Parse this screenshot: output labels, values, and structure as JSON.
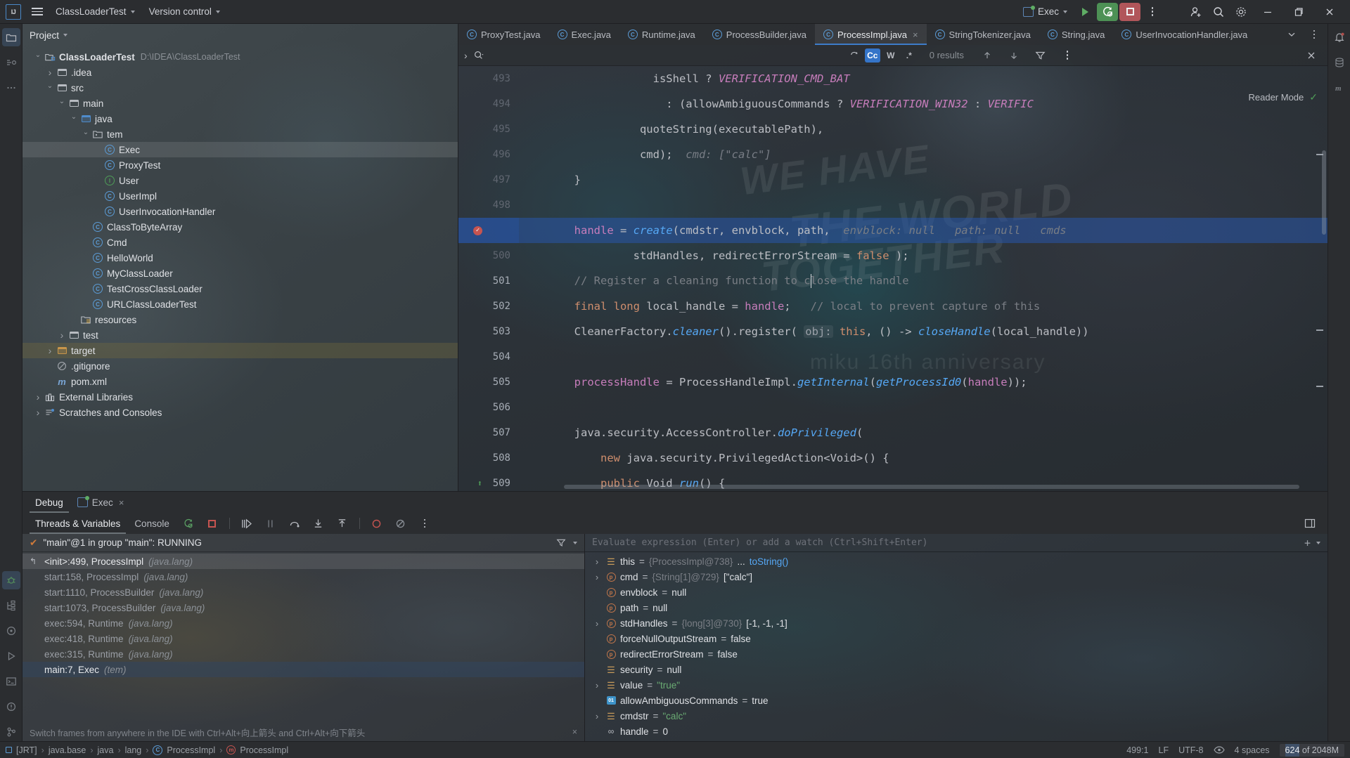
{
  "titlebar": {
    "logo": "IJ",
    "menu_icon": "hamburger-menu-icon",
    "project_name": "ClassLoaderTest",
    "version_control": "Version control",
    "run_config": "Exec",
    "run_icon": "run-icon",
    "debug_icon": "rerun-debug-icon",
    "stop_icon": "stop-icon",
    "more_icon": "more-options-icon",
    "account_icon": "account-icon",
    "search_icon": "search-icon",
    "settings_icon": "settings-gear-icon",
    "minimize_icon": "minimize-icon",
    "maximize_icon": "maximize-icon",
    "close_icon": "close-icon"
  },
  "project": {
    "panel_title": "Project",
    "tree": [
      {
        "label": "ClassLoaderTest",
        "path": "D:\\IDEA\\ClassLoaderTest",
        "indent": 0,
        "arrow": "down",
        "icon": "module-folder",
        "bold": true
      },
      {
        "label": ".idea",
        "indent": 1,
        "arrow": "right",
        "icon": "folder"
      },
      {
        "label": "src",
        "indent": 1,
        "arrow": "down",
        "icon": "folder"
      },
      {
        "label": "main",
        "indent": 2,
        "arrow": "down",
        "icon": "folder"
      },
      {
        "label": "java",
        "indent": 3,
        "arrow": "down",
        "icon": "folder-blue"
      },
      {
        "label": "tem",
        "indent": 4,
        "arrow": "down",
        "icon": "package"
      },
      {
        "label": "Exec",
        "indent": 5,
        "arrow": "",
        "icon": "class",
        "state": "selected"
      },
      {
        "label": "ProxyTest",
        "indent": 5,
        "arrow": "",
        "icon": "class"
      },
      {
        "label": "User",
        "indent": 5,
        "arrow": "",
        "icon": "interface"
      },
      {
        "label": "UserImpl",
        "indent": 5,
        "arrow": "",
        "icon": "class"
      },
      {
        "label": "UserInvocationHandler",
        "indent": 5,
        "arrow": "",
        "icon": "class"
      },
      {
        "label": "ClassToByteArray",
        "indent": 4,
        "arrow": "",
        "icon": "class"
      },
      {
        "label": "Cmd",
        "indent": 4,
        "arrow": "",
        "icon": "class"
      },
      {
        "label": "HelloWorld",
        "indent": 4,
        "arrow": "",
        "icon": "class"
      },
      {
        "label": "MyClassLoader",
        "indent": 4,
        "arrow": "",
        "icon": "class"
      },
      {
        "label": "TestCrossClassLoader",
        "indent": 4,
        "arrow": "",
        "icon": "class"
      },
      {
        "label": "URLClassLoaderTest",
        "indent": 4,
        "arrow": "",
        "icon": "class"
      },
      {
        "label": "resources",
        "indent": 3,
        "arrow": "",
        "icon": "resource-folder"
      },
      {
        "label": "test",
        "indent": 2,
        "arrow": "right",
        "icon": "folder"
      },
      {
        "label": "target",
        "indent": 1,
        "arrow": "right",
        "icon": "folder-orange",
        "state": "olive"
      },
      {
        "label": ".gitignore",
        "indent": 1,
        "arrow": "",
        "icon": "ignored-file"
      },
      {
        "label": "pom.xml",
        "indent": 1,
        "arrow": "",
        "icon": "maven"
      },
      {
        "label": "External Libraries",
        "indent": 0,
        "arrow": "right",
        "icon": "libraries"
      },
      {
        "label": "Scratches and Consoles",
        "indent": 0,
        "arrow": "right",
        "icon": "scratches"
      }
    ]
  },
  "editor": {
    "tabs": [
      {
        "label": "ProxyTest.java",
        "active": false
      },
      {
        "label": "Exec.java",
        "active": false
      },
      {
        "label": "Runtime.java",
        "active": false
      },
      {
        "label": "ProcessBuilder.java",
        "active": false
      },
      {
        "label": "ProcessImpl.java",
        "active": true,
        "closable": true
      },
      {
        "label": "StringTokenizer.java",
        "active": false
      },
      {
        "label": "String.java",
        "active": false
      },
      {
        "label": "UserInvocationHandler.java",
        "active": false
      }
    ],
    "tabs_overflow_icon": "chevron-down-icon",
    "tabs_more_icon": "more-options-icon",
    "notifications_icon": "notifications-bell-icon",
    "find": {
      "expand_icon": "chevron-right-icon",
      "search_icon": "search-dropdown-icon",
      "value": "",
      "regex_history_icon": "search-history-icon",
      "match_case": "Cc",
      "words": "W",
      "regex": ".*",
      "results": "0 results",
      "prev_icon": "arrow-up-icon",
      "next_icon": "arrow-down-icon",
      "filter_icon": "filter-icon",
      "more_icon": "more-options-icon",
      "close_icon": "close-icon"
    },
    "reader_mode": "Reader Mode",
    "reader_check_icon": "checkmark-icon",
    "lines": [
      {
        "n": "493",
        "dim": true,
        "tokens": [
          {
            "t": "                    ",
            "c": "plain"
          },
          {
            "t": "isShell ",
            "c": "plain"
          },
          {
            "t": "? ",
            "c": "plain"
          },
          {
            "t": "VERIFICATION_CMD_BAT",
            "c": "cnst"
          }
        ]
      },
      {
        "n": "494",
        "dim": true,
        "tokens": [
          {
            "t": "                      : (",
            "c": "plain"
          },
          {
            "t": "allowAmbiguousCommands ",
            "c": "plain"
          },
          {
            "t": "? ",
            "c": "plain"
          },
          {
            "t": "VERIFICATION_WIN32",
            "c": "cnst"
          },
          {
            "t": " : ",
            "c": "plain"
          },
          {
            "t": "VERIFIC",
            "c": "cnst"
          }
        ]
      },
      {
        "n": "495",
        "dim": true,
        "tokens": [
          {
            "t": "                  quoteString(executablePath),",
            "c": "plain"
          }
        ]
      },
      {
        "n": "496",
        "dim": true,
        "tokens": [
          {
            "t": "                  cmd);  ",
            "c": "plain"
          },
          {
            "t": "cmd: [\"calc\"]",
            "c": "hint"
          }
        ]
      },
      {
        "n": "497",
        "dim": true,
        "tokens": [
          {
            "t": "        }",
            "c": "plain"
          }
        ]
      },
      {
        "n": "498",
        "dim": true,
        "tokens": [
          {
            "t": "",
            "c": "plain"
          }
        ]
      },
      {
        "n": "499",
        "dim": false,
        "exec": true,
        "breakpoint": true,
        "tokens": [
          {
            "t": "        ",
            "c": "plain"
          },
          {
            "t": "handle",
            "c": "fld"
          },
          {
            "t": " = ",
            "c": "plain"
          },
          {
            "t": "create",
            "c": "mth"
          },
          {
            "t": "(cmdstr, envblock, path,  ",
            "c": "plain"
          },
          {
            "t": "envblock: null",
            "c": "hint"
          },
          {
            "t": "   ",
            "c": "plain"
          },
          {
            "t": "path: null",
            "c": "hint"
          },
          {
            "t": "   ",
            "c": "plain"
          },
          {
            "t": "cmds",
            "c": "hint"
          }
        ]
      },
      {
        "n": "500",
        "dim": true,
        "tokens": [
          {
            "t": "                 stdHandles, redirectErrorStream ",
            "c": "plain"
          },
          {
            "t": "= ",
            "c": "plain"
          },
          {
            "t": "false",
            "c": "kw"
          },
          {
            "t": " );",
            "c": "plain"
          }
        ]
      },
      {
        "n": "501",
        "dim": false,
        "cursor": true,
        "tokens": [
          {
            "t": "        ",
            "c": "plain"
          },
          {
            "t": "// Register a cleaning function to close the handle",
            "c": "cmt"
          }
        ]
      },
      {
        "n": "502",
        "dim": false,
        "tokens": [
          {
            "t": "        ",
            "c": "plain"
          },
          {
            "t": "final long",
            "c": "kw"
          },
          {
            "t": " local_handle = ",
            "c": "plain"
          },
          {
            "t": "handle",
            "c": "fld"
          },
          {
            "t": ";   ",
            "c": "plain"
          },
          {
            "t": "// local to prevent capture of this",
            "c": "cmt"
          }
        ]
      },
      {
        "n": "503",
        "dim": false,
        "tokens": [
          {
            "t": "        CleanerFactory.",
            "c": "plain"
          },
          {
            "t": "cleaner",
            "c": "mth"
          },
          {
            "t": "().register( ",
            "c": "plain"
          },
          {
            "t": "obj:",
            "c": "hintbox"
          },
          {
            "t": " ",
            "c": "plain"
          },
          {
            "t": "this",
            "c": "kw"
          },
          {
            "t": ", () -> ",
            "c": "plain"
          },
          {
            "t": "closeHandle",
            "c": "mth"
          },
          {
            "t": "(local_handle))",
            "c": "plain"
          }
        ]
      },
      {
        "n": "504",
        "dim": false,
        "tokens": [
          {
            "t": "",
            "c": "plain"
          }
        ]
      },
      {
        "n": "505",
        "dim": false,
        "tokens": [
          {
            "t": "        ",
            "c": "plain"
          },
          {
            "t": "processHandle",
            "c": "fld"
          },
          {
            "t": " = ProcessHandleImpl.",
            "c": "plain"
          },
          {
            "t": "getInternal",
            "c": "mth"
          },
          {
            "t": "(",
            "c": "plain"
          },
          {
            "t": "getProcessId0",
            "c": "mth"
          },
          {
            "t": "(",
            "c": "plain"
          },
          {
            "t": "handle",
            "c": "fld"
          },
          {
            "t": "));",
            "c": "plain"
          }
        ]
      },
      {
        "n": "506",
        "dim": false,
        "tokens": [
          {
            "t": "",
            "c": "plain"
          }
        ]
      },
      {
        "n": "507",
        "dim": false,
        "tokens": [
          {
            "t": "        java.security.AccessController.",
            "c": "plain"
          },
          {
            "t": "doPrivileged",
            "c": "mth"
          },
          {
            "t": "(",
            "c": "plain"
          }
        ]
      },
      {
        "n": "508",
        "dim": false,
        "tokens": [
          {
            "t": "            ",
            "c": "plain"
          },
          {
            "t": "new",
            "c": "kw"
          },
          {
            "t": " java.security.PrivilegedAction<Void>() {",
            "c": "plain"
          }
        ]
      },
      {
        "n": "509",
        "dim": false,
        "override": true,
        "tokens": [
          {
            "t": "            ",
            "c": "plain"
          },
          {
            "t": "public",
            "c": "kw"
          },
          {
            "t": " Void ",
            "c": "plain"
          },
          {
            "t": "run",
            "c": "mth"
          },
          {
            "t": "() {",
            "c": "plain"
          }
        ]
      }
    ],
    "watermark_lines": [
      "WE HAVE",
      "THE WORLD",
      "TOGETHER",
      "miku 16th anniversary"
    ]
  },
  "debug": {
    "tabs": [
      {
        "label": "Debug",
        "active": true
      },
      {
        "label": "Exec",
        "active": false,
        "closable": true,
        "icon": "run-config-icon"
      }
    ],
    "subtabs": [
      {
        "label": "Threads & Variables",
        "active": true
      },
      {
        "label": "Console",
        "active": false
      }
    ],
    "tool_icons": [
      "rerun-icon",
      "stop-icon",
      "resume-program-icon",
      "pause-program-icon",
      "step-over-icon",
      "step-into-icon",
      "step-out-icon",
      "view-breakpoints-icon",
      "mute-breakpoints-icon",
      "more-options-icon"
    ],
    "filter_icon": "filter-icon",
    "settings_icon": "chevron-down-icon",
    "thread": "\"main\"@1 in group \"main\": RUNNING",
    "thread_status_icon": "running-checkmark-icon",
    "frames": [
      {
        "label": "<init>:499, ProcessImpl",
        "pkg": "(java.lang)",
        "state": "selected",
        "icon": "current-frame-icon"
      },
      {
        "label": "start:158, ProcessImpl",
        "pkg": "(java.lang)",
        "state": "dim"
      },
      {
        "label": "start:1110, ProcessBuilder",
        "pkg": "(java.lang)",
        "state": "dim"
      },
      {
        "label": "start:1073, ProcessBuilder",
        "pkg": "(java.lang)",
        "state": "dim"
      },
      {
        "label": "exec:594, Runtime",
        "pkg": "(java.lang)",
        "state": "dim"
      },
      {
        "label": "exec:418, Runtime",
        "pkg": "(java.lang)",
        "state": "dim"
      },
      {
        "label": "exec:315, Runtime",
        "pkg": "(java.lang)",
        "state": "dim"
      },
      {
        "label": "main:7, Exec",
        "pkg": "(tem)",
        "state": "highlighted"
      }
    ],
    "frames_hint": "Switch frames from anywhere in the IDE with Ctrl+Alt+向上箭头 and Ctrl+Alt+向下箭头",
    "frames_hint_close_icon": "close-icon",
    "eval_placeholder": "Evaluate expression (Enter) or add a watch (Ctrl+Shift+Enter)",
    "eval_add_icon": "add-watch-icon",
    "eval_collapse_icon": "chevron-down-icon",
    "variables": [
      {
        "expandable": true,
        "icon": "field",
        "name": "this",
        "eq": "=",
        "ref": "{ProcessImpl@738}",
        "extra": " ... ",
        "link": "toString()"
      },
      {
        "expandable": true,
        "icon": "param",
        "name": "cmd",
        "eq": "=",
        "ref": "{String[1]@729}",
        "value": " [\"calc\"]"
      },
      {
        "expandable": false,
        "icon": "param",
        "name": "envblock",
        "eq": "=",
        "value": " null"
      },
      {
        "expandable": false,
        "icon": "param",
        "name": "path",
        "eq": "=",
        "value": " null"
      },
      {
        "expandable": true,
        "icon": "param",
        "name": "stdHandles",
        "eq": "=",
        "ref": "{long[3]@730}",
        "value": " [-1, -1, -1]"
      },
      {
        "expandable": false,
        "icon": "param",
        "name": "forceNullOutputStream",
        "eq": "=",
        "value": " false"
      },
      {
        "expandable": false,
        "icon": "param",
        "name": "redirectErrorStream",
        "eq": "=",
        "value": " false"
      },
      {
        "expandable": false,
        "icon": "field",
        "name": "security",
        "eq": "=",
        "value": " null"
      },
      {
        "expandable": true,
        "icon": "field",
        "name": "value",
        "eq": "=",
        "str": " \"true\""
      },
      {
        "expandable": false,
        "icon": "bool",
        "name": "allowAmbiguousCommands",
        "eq": "=",
        "value": " true"
      },
      {
        "expandable": true,
        "icon": "field",
        "name": "cmdstr",
        "eq": "=",
        "str": " \"calc\""
      },
      {
        "expandable": false,
        "icon": "prim",
        "name": "handle",
        "eq": "=",
        "value": " 0"
      }
    ]
  },
  "statusbar": {
    "breadcrumbs": [
      "[JRT]",
      "java.base",
      "java",
      "lang",
      "ProcessImpl",
      "ProcessImpl"
    ],
    "caret": "499:1",
    "line_sep": "LF",
    "encoding": "UTF-8",
    "eye_icon": "reader-mode-icon",
    "indent": "4 spaces",
    "memory_used": "624",
    "memory_total": " of 2048M"
  },
  "left_rail_icons": [
    "project-icon",
    "commit-icon",
    "more-tool-windows-icon",
    "debug-icon",
    "structure-icon",
    "services-icon",
    "run-icon",
    "terminal-icon",
    "problems-icon",
    "git-icon"
  ],
  "right_rail_icons": [
    "notifications-icon",
    "database-icon",
    "maven-icon"
  ],
  "colors": {
    "accent_blue": "#3574c8",
    "exec_line": "#2d55aa",
    "breakpoint_red": "#c75450",
    "run_green": "#4d9155",
    "stop_red": "#b1565a",
    "background": "#2b2d30"
  }
}
